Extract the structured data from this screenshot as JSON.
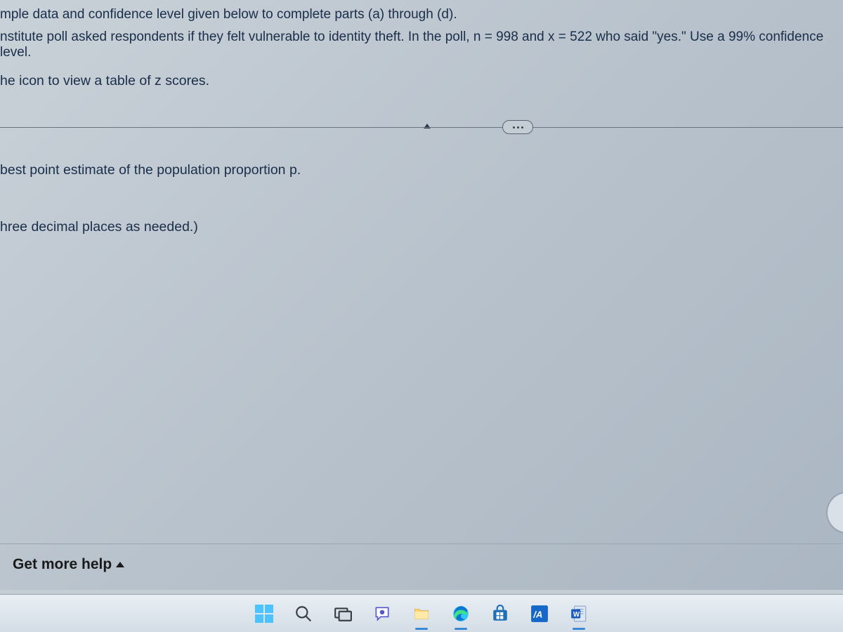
{
  "problem": {
    "line1": "mple data and confidence level given below to complete parts (a) through (d).",
    "line2": "nstitute poll asked respondents if they felt vulnerable to identity theft. In the poll, n = 998 and x = 522 who said \"yes.\" Use a 99% confidence level.",
    "line3": "he icon to view a table of z scores.",
    "line4": "best point estimate of the population proportion p.",
    "line5": "hree decimal places as needed.)"
  },
  "help": {
    "label": "Get more help"
  },
  "taskbar": {
    "start": "Start",
    "search": "Search",
    "taskview": "Task View",
    "chat": "Chat",
    "explorer": "File Explorer",
    "edge": "Microsoft Edge",
    "store": "Microsoft Store",
    "app_la": "LA",
    "word": "W"
  }
}
